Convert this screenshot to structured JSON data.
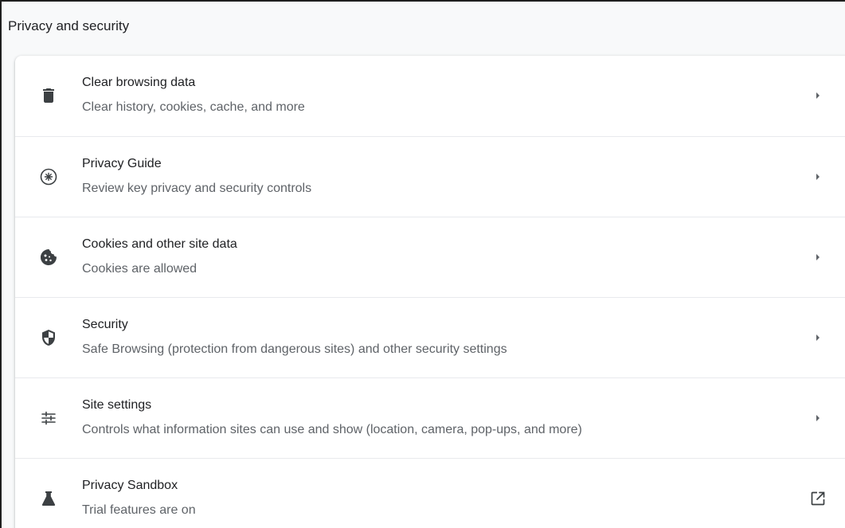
{
  "section": {
    "title": "Privacy and security"
  },
  "rows": [
    {
      "icon": "trash-icon",
      "title": "Clear browsing data",
      "subtitle": "Clear history, cookies, cache, and more",
      "action_icon": "arrow-right-icon"
    },
    {
      "icon": "compass-icon",
      "title": "Privacy Guide",
      "subtitle": "Review key privacy and security controls",
      "action_icon": "arrow-right-icon"
    },
    {
      "icon": "cookie-icon",
      "title": "Cookies and other site data",
      "subtitle": "Cookies are allowed",
      "action_icon": "arrow-right-icon"
    },
    {
      "icon": "shield-icon",
      "title": "Security",
      "subtitle": "Safe Browsing (protection from dangerous sites) and other security settings",
      "action_icon": "arrow-right-icon"
    },
    {
      "icon": "tune-icon",
      "title": "Site settings",
      "subtitle": "Controls what information sites can use and show (location, camera, pop-ups, and more)",
      "action_icon": "arrow-right-icon"
    },
    {
      "icon": "flask-icon",
      "title": "Privacy Sandbox",
      "subtitle": "Trial features are on",
      "action_icon": "open-in-new-icon"
    }
  ],
  "colors": {
    "title_text": "#202124",
    "subtitle_text": "#5f6368",
    "icon": "#5f6368",
    "divider": "#e8eaed"
  }
}
